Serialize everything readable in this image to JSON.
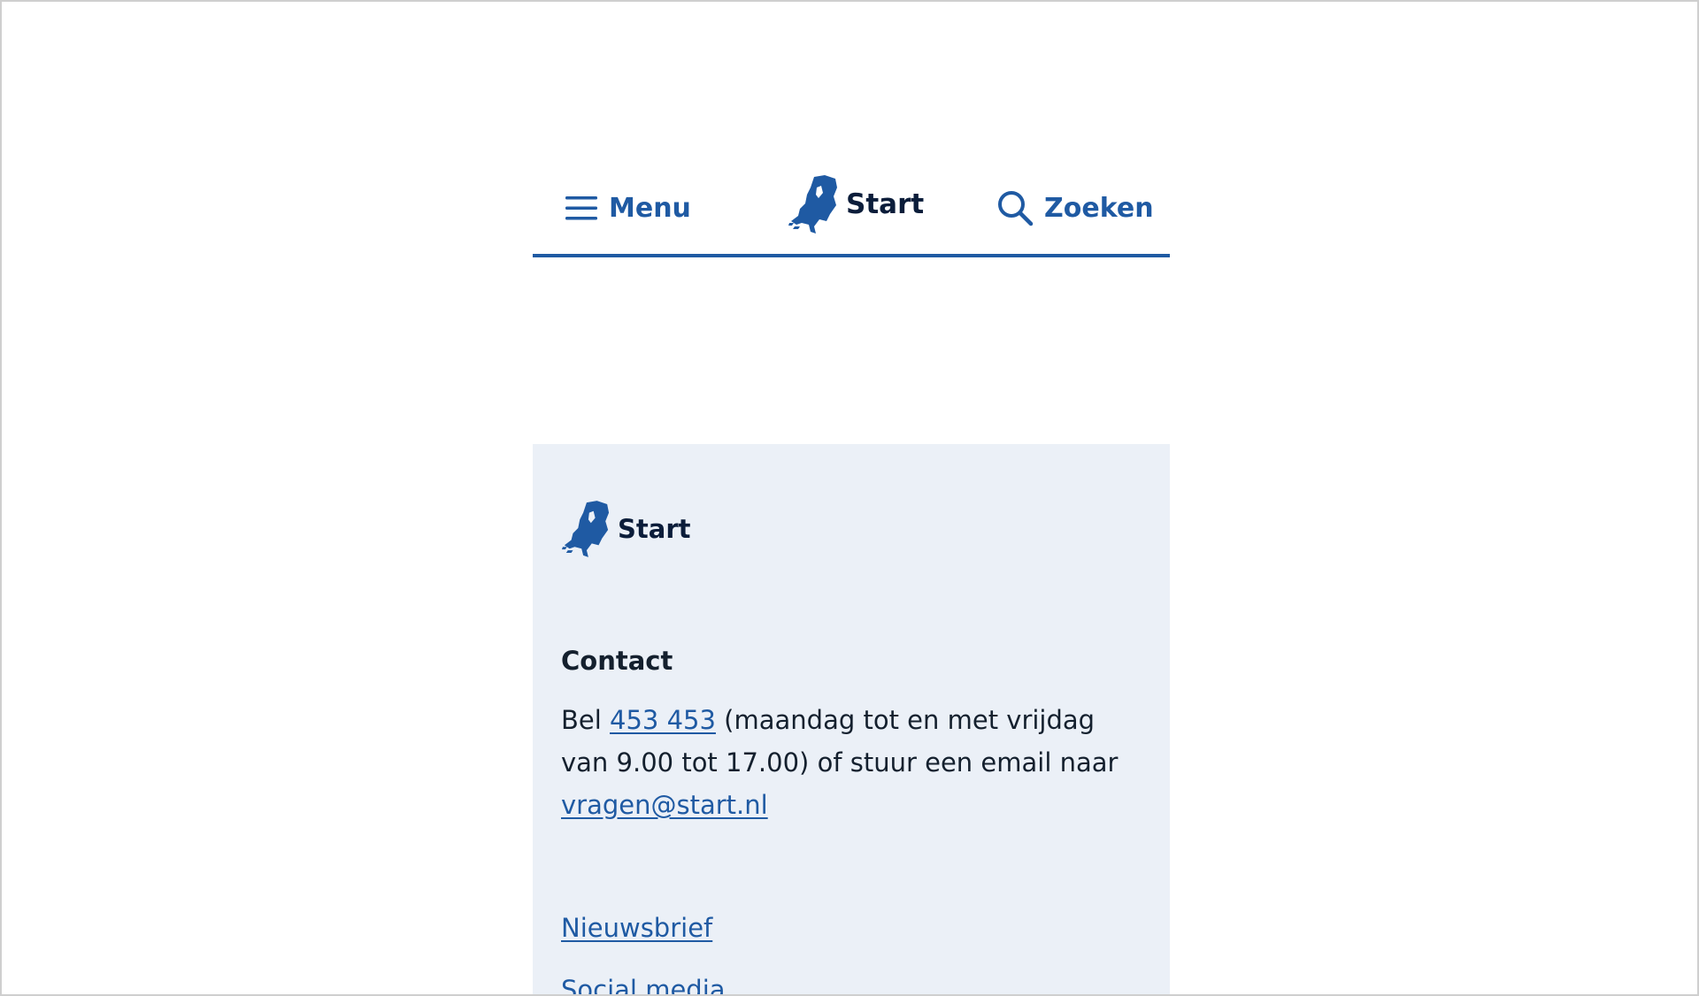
{
  "header": {
    "menu_label": "Menu",
    "logo_label": "Start",
    "search_label": "Zoeken"
  },
  "colors": {
    "accent": "#1f5aa3",
    "footer_bg": "#ebf0f7",
    "text": "#14202e"
  },
  "footer": {
    "logo_label": "Start",
    "contact": {
      "heading": "Contact",
      "prefix": "Bel ",
      "phone": "453 453",
      "middle": " (maandag tot en met vrijdag van 9.00 tot 17.00) of stuur een email naar ",
      "email": "vragen@start.nl"
    },
    "links": [
      {
        "label": "Nieuwsbrief"
      },
      {
        "label": "Social media"
      }
    ]
  }
}
